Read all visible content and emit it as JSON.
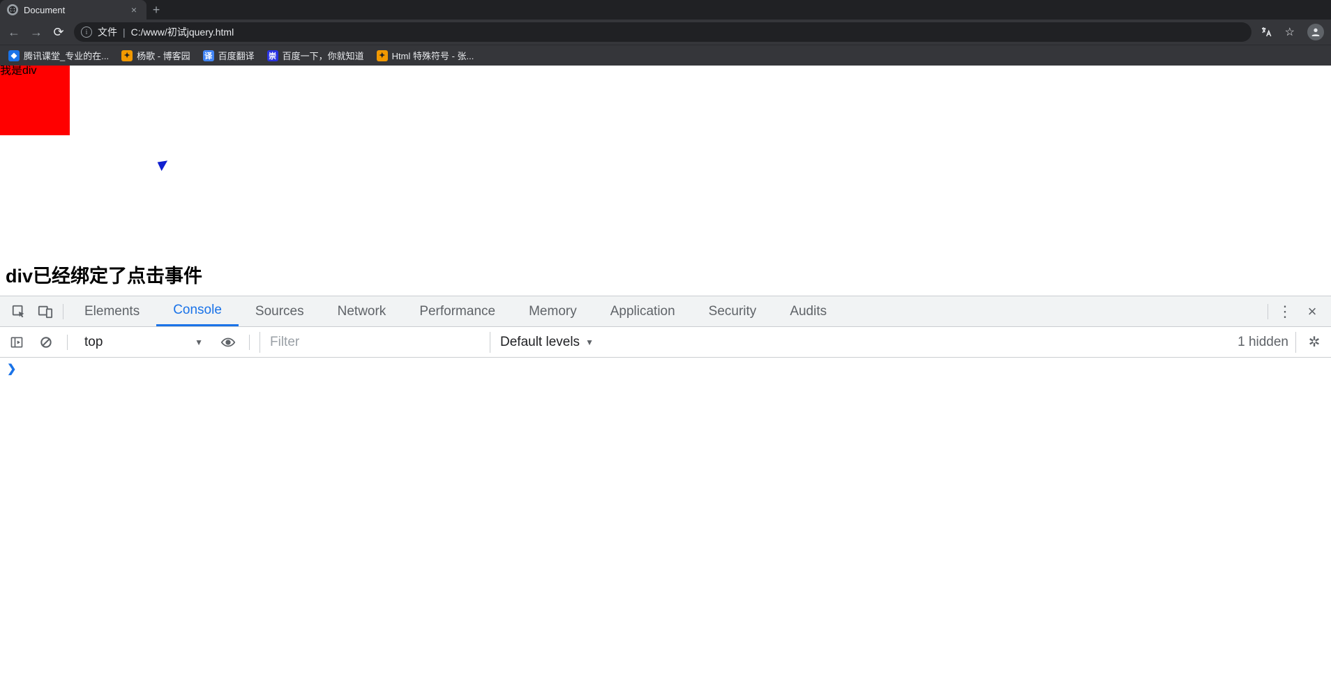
{
  "browser": {
    "tab_title": "Document",
    "url_prefix": "文件",
    "url_separator": "|",
    "url_path": "C:/www/初试jquery.html",
    "bookmarks": [
      {
        "label": "腾讯课堂_专业的在...",
        "icon": "blue"
      },
      {
        "label": "杨歌 - 博客园",
        "icon": "orange"
      },
      {
        "label": "百度翻译",
        "icon": "bluebox",
        "glyph": "译"
      },
      {
        "label": "百度一下，你就知道",
        "icon": "baidu",
        "glyph": "崇"
      },
      {
        "label": "Html 特殊符号 - 张...",
        "icon": "orange"
      }
    ]
  },
  "page": {
    "redbox_text": "我是div",
    "heading": "div已经绑定了点击事件"
  },
  "devtools": {
    "tabs": [
      "Elements",
      "Console",
      "Sources",
      "Network",
      "Performance",
      "Memory",
      "Application",
      "Security",
      "Audits"
    ],
    "active_tab": "Console",
    "context": "top",
    "filter_placeholder": "Filter",
    "levels": "Default levels",
    "hidden": "1 hidden"
  }
}
